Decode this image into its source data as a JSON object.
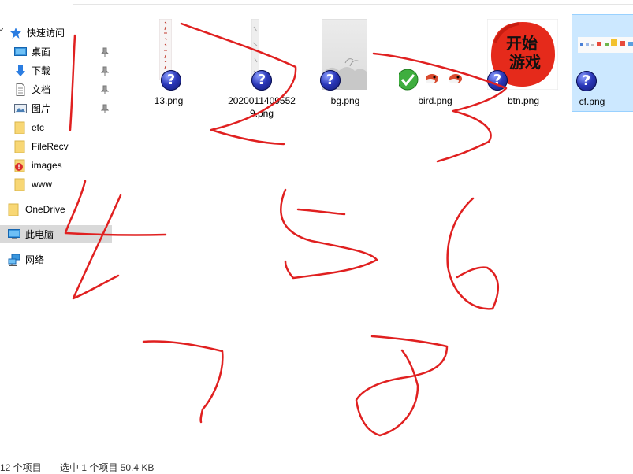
{
  "nav": {
    "quick_access": "快速访问",
    "desktop": "桌面",
    "downloads": "下载",
    "documents": "文档",
    "pictures": "图片",
    "etc": "etc",
    "filerecv": "FileRecv",
    "images": "images",
    "www": "www",
    "onedrive": "OneDrive",
    "this_pc": "此电脑",
    "network": "网络"
  },
  "files": [
    {
      "name": "13.png",
      "icon": "image-strip-thumb-icon"
    },
    {
      "name": "20200114095529.png",
      "icon": "image-strip-thumb-icon"
    },
    {
      "name": "bg.png",
      "icon": "ink-landscape-thumb-icon"
    },
    {
      "name": "bird.png",
      "icon": "bird-sprite-thumb-icon"
    },
    {
      "name": "btn.png",
      "icon": "start-game-seal-thumb-icon"
    },
    {
      "name": "cf.png",
      "icon": "sprite-sheet-thumb-icon"
    }
  ],
  "btn_thumb_text": [
    "开始",
    "游戏"
  ],
  "overlay_icon": "?",
  "status": {
    "count": "12 个项目",
    "selection": "选中 1 个项目  50.4 KB"
  },
  "colors": {
    "accent_blue": "#0078d7",
    "selection_bg": "#cce8ff",
    "selection_border": "#99d1ff",
    "annotation_red": "#e02020",
    "folder_yellow": "#f8d775"
  },
  "annotations": [
    "1",
    "2",
    "3",
    "4",
    "5",
    "6",
    "7",
    "8"
  ]
}
